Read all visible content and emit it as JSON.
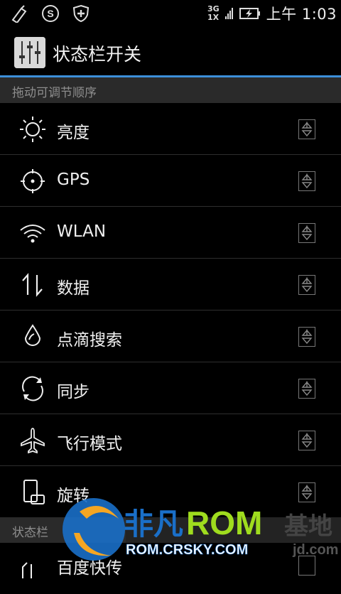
{
  "status_bar": {
    "icons": [
      "usb-debug-icon",
      "s-app-icon",
      "shield-icon"
    ],
    "network_top": "3G",
    "network_bottom": "1X",
    "time": "上午 1:03"
  },
  "header": {
    "title": "状态栏开关",
    "icon": "sliders-icon"
  },
  "section_order": {
    "title": "拖动可调节顺序"
  },
  "items": [
    {
      "label": "亮度",
      "icon": "brightness-icon"
    },
    {
      "label": "GPS",
      "icon": "gps-icon"
    },
    {
      "label": "WLAN",
      "icon": "wifi-icon"
    },
    {
      "label": "数据",
      "icon": "data-arrows-icon"
    },
    {
      "label": "点滴搜索",
      "icon": "drop-icon"
    },
    {
      "label": "同步",
      "icon": "sync-icon"
    },
    {
      "label": "飞行模式",
      "icon": "airplane-icon"
    },
    {
      "label": "旋转",
      "icon": "rotate-icon"
    }
  ],
  "section_hidden": {
    "title": "状态栏"
  },
  "partial_item": {
    "label": "百度快传"
  },
  "watermark": {
    "brand": "非凡",
    "rom": "ROM",
    "url": "ROM.CRSKY.COM",
    "suffix": "基地",
    "suffix_url": "jd.com"
  }
}
